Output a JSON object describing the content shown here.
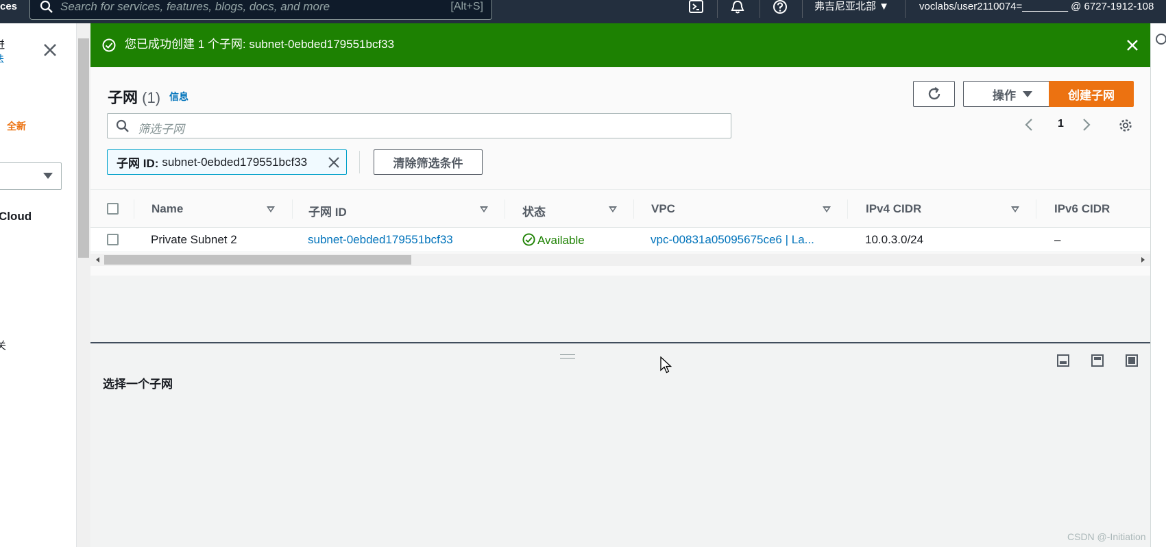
{
  "topbar": {
    "services_fragment": "ces",
    "search_placeholder": "Search for services, features, blogs, docs, and more",
    "search_shortcut": "[Alt+S]",
    "region": "弗吉尼亚北部 ▼",
    "user": "voclabs/user2110074=________ @ 6727-1912-108"
  },
  "left_panel": {
    "text_top": "迸",
    "text_link": "法",
    "new_tag": "全新",
    "cloud_text": "Cloud",
    "guan_text": "关"
  },
  "flash": {
    "message": "您已成功创建 1 个子网: subnet-0ebded179551bcf33"
  },
  "header": {
    "title": "子网",
    "count": "(1)",
    "info": "信息",
    "actions_label": "操作",
    "create_label": "创建子网"
  },
  "filter": {
    "placeholder": "筛选子网",
    "token_key": "子网 ID:",
    "token_value": "subnet-0ebded179551bcf33",
    "clear_label": "清除筛选条件"
  },
  "pagination": {
    "current_page": "1"
  },
  "table": {
    "columns": [
      "Name",
      "子网 ID",
      "状态",
      "VPC",
      "IPv4 CIDR",
      "IPv6 CIDR"
    ],
    "rows": [
      {
        "name": "Private Subnet 2",
        "subnet_id": "subnet-0ebded179551bcf33",
        "status": "Available",
        "vpc": "vpc-00831a05095675ce6 | La...",
        "ipv4": "10.0.3.0/24",
        "ipv6": "–"
      }
    ]
  },
  "detail": {
    "title": "选择一个子网"
  },
  "watermark": "CSDN @-Initiation",
  "colors": {
    "topbar": "#232f3e",
    "success": "#1d8102",
    "primary": "#ec7211",
    "link": "#0073bb"
  }
}
